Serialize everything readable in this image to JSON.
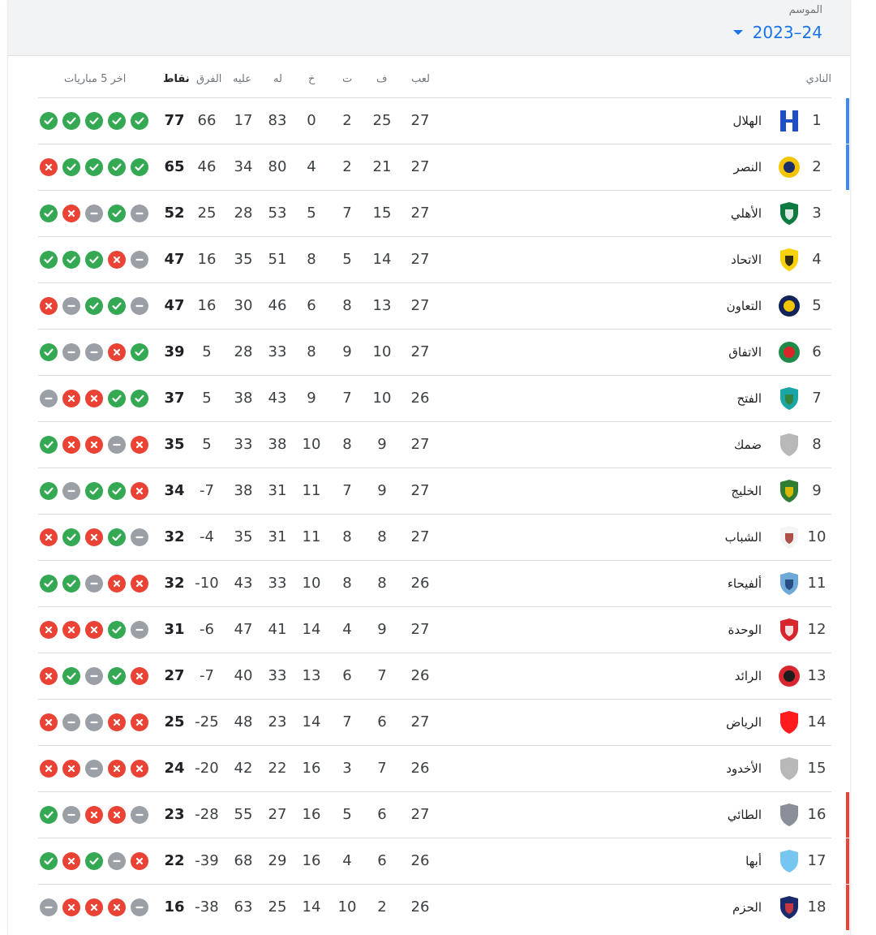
{
  "season": {
    "label": "الموسم",
    "value": "2023–24"
  },
  "headers": {
    "club": "النادي",
    "mp": "لعب",
    "w": "ف",
    "d": "ت",
    "l": "خ",
    "gf": "له",
    "ga": "عليه",
    "gd": "الفرق",
    "pts": "نقاط",
    "form": "اخر 5 مباريات"
  },
  "colors": {
    "win": "#34a853",
    "loss": "#ea4335",
    "draw": "#9aa0a6",
    "champions": "#4285f4",
    "relegation": "#ea4335"
  },
  "rows": [
    {
      "pos": "1",
      "name": "الهلال",
      "mp": "27",
      "w": "25",
      "d": "2",
      "l": "0",
      "gf": "83",
      "ga": "17",
      "gd": "66",
      "pts": "77",
      "form": [
        "w",
        "w",
        "w",
        "w",
        "w"
      ],
      "zone": "champions",
      "crest": "blue-h"
    },
    {
      "pos": "2",
      "name": "النصر",
      "mp": "27",
      "w": "21",
      "d": "2",
      "l": "4",
      "gf": "80",
      "ga": "34",
      "gd": "46",
      "pts": "65",
      "form": [
        "l",
        "w",
        "w",
        "w",
        "w"
      ],
      "zone": "champions",
      "crest": "yellow-round"
    },
    {
      "pos": "3",
      "name": "الأهلي",
      "mp": "27",
      "w": "15",
      "d": "7",
      "l": "5",
      "gf": "53",
      "ga": "28",
      "gd": "25",
      "pts": "52",
      "form": [
        "w",
        "l",
        "d",
        "w",
        "d"
      ],
      "zone": "",
      "crest": "green-shield"
    },
    {
      "pos": "4",
      "name": "الاتحاد",
      "mp": "27",
      "w": "14",
      "d": "5",
      "l": "8",
      "gf": "51",
      "ga": "35",
      "gd": "16",
      "pts": "47",
      "form": [
        "w",
        "w",
        "w",
        "l",
        "d"
      ],
      "zone": "",
      "crest": "yellow-shield"
    },
    {
      "pos": "5",
      "name": "التعاون",
      "mp": "27",
      "w": "13",
      "d": "8",
      "l": "6",
      "gf": "46",
      "ga": "30",
      "gd": "16",
      "pts": "47",
      "form": [
        "l",
        "d",
        "w",
        "w",
        "d"
      ],
      "zone": "",
      "crest": "navy-round"
    },
    {
      "pos": "6",
      "name": "الاتفاق",
      "mp": "27",
      "w": "10",
      "d": "9",
      "l": "8",
      "gf": "33",
      "ga": "28",
      "gd": "5",
      "pts": "39",
      "form": [
        "w",
        "d",
        "d",
        "l",
        "w"
      ],
      "zone": "",
      "crest": "green-red-round"
    },
    {
      "pos": "7",
      "name": "الفتح",
      "mp": "26",
      "w": "10",
      "d": "7",
      "l": "9",
      "gf": "43",
      "ga": "38",
      "gd": "5",
      "pts": "37",
      "form": [
        "d",
        "l",
        "l",
        "w",
        "w"
      ],
      "zone": "",
      "crest": "teal-shield"
    },
    {
      "pos": "8",
      "name": "ضمك",
      "mp": "27",
      "w": "9",
      "d": "8",
      "l": "10",
      "gf": "38",
      "ga": "33",
      "gd": "5",
      "pts": "35",
      "form": [
        "w",
        "l",
        "l",
        "d",
        "l"
      ],
      "zone": "",
      "crest": "gray-shield"
    },
    {
      "pos": "9",
      "name": "الخليج",
      "mp": "27",
      "w": "9",
      "d": "7",
      "l": "11",
      "gf": "31",
      "ga": "38",
      "gd": "-7",
      "pts": "34",
      "form": [
        "w",
        "d",
        "w",
        "w",
        "l"
      ],
      "zone": "",
      "crest": "green-yellow-shield"
    },
    {
      "pos": "10",
      "name": "الشباب",
      "mp": "27",
      "w": "8",
      "d": "8",
      "l": "11",
      "gf": "31",
      "ga": "35",
      "gd": "-4",
      "pts": "32",
      "form": [
        "l",
        "w",
        "l",
        "w",
        "d"
      ],
      "zone": "",
      "crest": "white-shield"
    },
    {
      "pos": "11",
      "name": "ألفيحاء",
      "mp": "26",
      "w": "8",
      "d": "8",
      "l": "10",
      "gf": "33",
      "ga": "43",
      "gd": "-10",
      "pts": "32",
      "form": [
        "w",
        "w",
        "d",
        "l",
        "l"
      ],
      "zone": "",
      "crest": "lightblue-shield"
    },
    {
      "pos": "12",
      "name": "الوحدة",
      "mp": "27",
      "w": "9",
      "d": "4",
      "l": "14",
      "gf": "41",
      "ga": "47",
      "gd": "-6",
      "pts": "31",
      "form": [
        "l",
        "l",
        "l",
        "w",
        "d"
      ],
      "zone": "",
      "crest": "red-white-shield"
    },
    {
      "pos": "13",
      "name": "الرائد",
      "mp": "26",
      "w": "7",
      "d": "6",
      "l": "13",
      "gf": "33",
      "ga": "40",
      "gd": "-7",
      "pts": "27",
      "form": [
        "l",
        "w",
        "d",
        "w",
        "l"
      ],
      "zone": "",
      "crest": "red-round"
    },
    {
      "pos": "14",
      "name": "الرياض",
      "mp": "27",
      "w": "6",
      "d": "7",
      "l": "14",
      "gf": "23",
      "ga": "48",
      "gd": "-25",
      "pts": "25",
      "form": [
        "l",
        "d",
        "d",
        "l",
        "l"
      ],
      "zone": "",
      "crest": "red-shield"
    },
    {
      "pos": "15",
      "name": "الأخدود",
      "mp": "26",
      "w": "7",
      "d": "3",
      "l": "16",
      "gf": "22",
      "ga": "42",
      "gd": "-20",
      "pts": "24",
      "form": [
        "l",
        "l",
        "d",
        "l",
        "l"
      ],
      "zone": "",
      "crest": "gray-shield"
    },
    {
      "pos": "16",
      "name": "الطائي",
      "mp": "27",
      "w": "6",
      "d": "5",
      "l": "16",
      "gf": "27",
      "ga": "55",
      "gd": "-28",
      "pts": "23",
      "form": [
        "w",
        "d",
        "l",
        "l",
        "d"
      ],
      "zone": "relegation",
      "crest": "darkgray-shield"
    },
    {
      "pos": "17",
      "name": "أبها",
      "mp": "26",
      "w": "6",
      "d": "4",
      "l": "16",
      "gf": "29",
      "ga": "68",
      "gd": "-39",
      "pts": "22",
      "form": [
        "w",
        "l",
        "w",
        "d",
        "l"
      ],
      "zone": "relegation",
      "crest": "skyblue-shield"
    },
    {
      "pos": "18",
      "name": "الحزم",
      "mp": "26",
      "w": "2",
      "d": "10",
      "l": "14",
      "gf": "25",
      "ga": "63",
      "gd": "-38",
      "pts": "16",
      "form": [
        "d",
        "l",
        "l",
        "l",
        "d"
      ],
      "zone": "relegation",
      "crest": "navy-shield"
    }
  ]
}
